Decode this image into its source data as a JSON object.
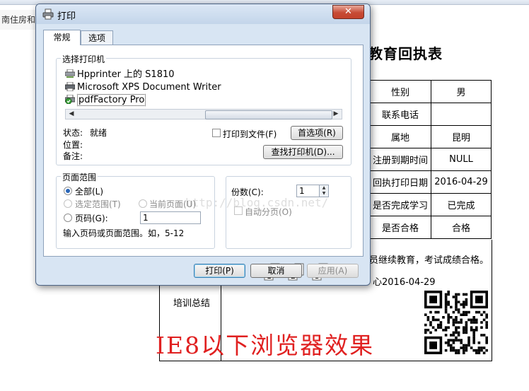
{
  "background": {
    "tab_snippet": "南住房和",
    "page_title": "教育回执表",
    "table_rows": [
      {
        "label": "性别",
        "value": "男"
      },
      {
        "label": "联系电话",
        "value": ""
      },
      {
        "label": "属地",
        "value": "昆明"
      },
      {
        "label": "注册到期时间",
        "value": "NULL"
      },
      {
        "label": "回执打印日期",
        "value": "2016-04-29"
      },
      {
        "label": "是否完成学习",
        "value": "已完成"
      },
      {
        "label": "是否合格",
        "value": "合格"
      }
    ],
    "summary_text": "员继续教育，考试成绩合格。",
    "summary_date": "心2016-04-29",
    "summary_label": "培训总结",
    "caption": "IE8以下浏览器效果",
    "watermark": "http://blog.csdn.net/"
  },
  "dialog": {
    "title": "打印",
    "close_glyph": "✕",
    "tabs": [
      "常规",
      "选项"
    ],
    "printer_group_label": "选择打印机",
    "printers": [
      {
        "name": "Hpprinter 上的 S1810",
        "icon": "network-printer-icon",
        "selected": false
      },
      {
        "name": "Microsoft XPS Document Writer",
        "icon": "printer-icon",
        "selected": false
      },
      {
        "name": "pdfFactory Pro",
        "icon": "default-printer-icon",
        "selected": true
      }
    ],
    "status_label": "状态:",
    "status_value": "就绪",
    "location_label": "位置:",
    "comment_label": "备注:",
    "print_to_file_label": "打印到文件(F)",
    "preferences_button": "首选项(R)",
    "find_printer_button": "查找打印机(D)...",
    "page_range": {
      "label": "页面范围",
      "all": "全部(L)",
      "selection": "选定范围(T)",
      "current_page": "当前页面(U)",
      "pages": "页码(G):",
      "pages_value": "1",
      "hint": "输入页码或页面范围。如，5-12"
    },
    "copies": {
      "label": "份数(C):",
      "value": "1",
      "collate_label": "自动分页(O)"
    },
    "buttons": {
      "print": "打印(P)",
      "cancel": "取消",
      "apply": "应用(A)"
    },
    "colors": {
      "accent": "#2a66b8",
      "close": "#c74b35"
    }
  }
}
